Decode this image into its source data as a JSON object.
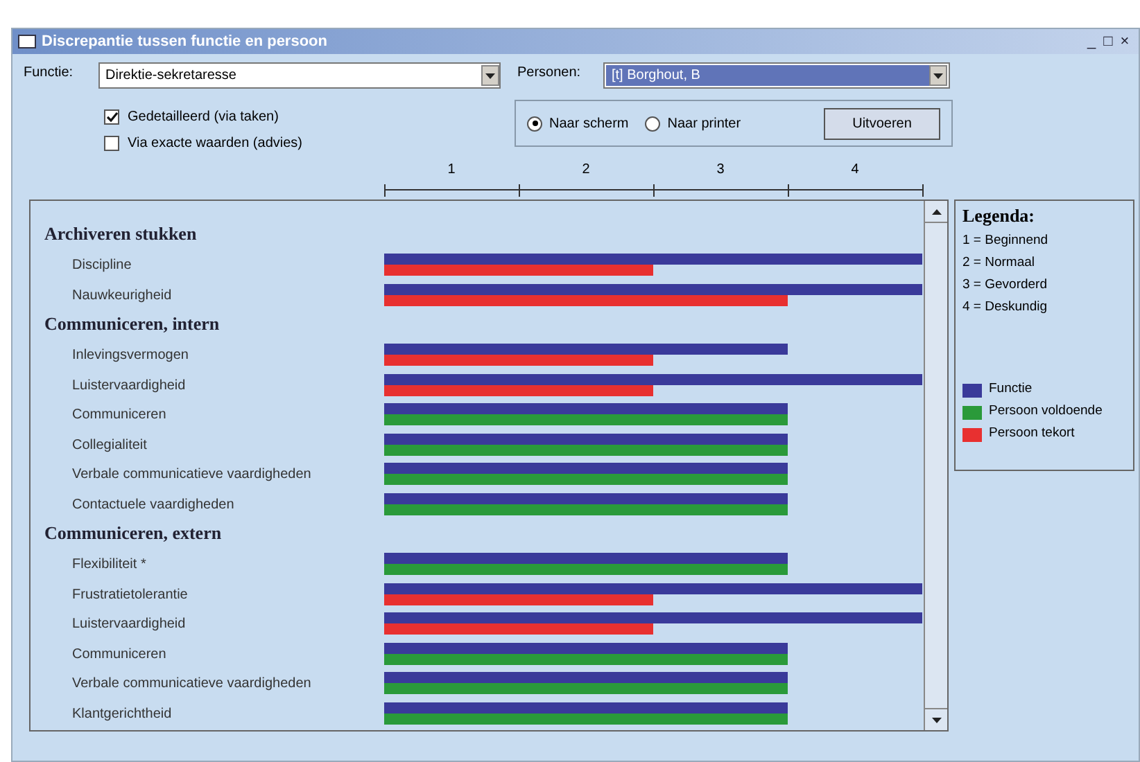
{
  "window": {
    "title": "Discrepantie tussen functie en persoon",
    "controls": [
      "_",
      "□",
      "×"
    ]
  },
  "functie": {
    "label": "Functie:",
    "value": "Direktie-sekretaresse"
  },
  "personen": {
    "label": "Personen:",
    "value": "[t] Borghout, B"
  },
  "options": [
    {
      "label": "Gedetailleerd (via taken)",
      "checked": true
    },
    {
      "label": "Via exacte waarden (advies)",
      "checked": false
    }
  ],
  "output": [
    {
      "label": "Naar scherm",
      "selected": true
    },
    {
      "label": "Naar printer",
      "selected": false
    }
  ],
  "run_button": "Uitvoeren",
  "chart": {
    "chart_data": {
      "type": "bar",
      "orientation": "horizontal",
      "categories": [
        "Discipline",
        "Nauwkeurigheid",
        "Inlevingsvermogen",
        "Luistervaardigheid",
        "Communiceren",
        "Collegialiteit",
        "Verbale communicatieve vaardigheden",
        "Contactuele vaardigheden",
        "Flexibiliteit *",
        "Frustratietolerantie",
        "Luistervaardigheid",
        "Communiceren",
        "Verbale communicatieve vaardigheden",
        "Klantgerichtheid"
      ],
      "xlim": [
        0,
        4
      ],
      "xticks": [
        {
          "value": 0.5,
          "label": "1"
        },
        {
          "value": 1.5,
          "label": "2"
        },
        {
          "value": 2.5,
          "label": "3"
        },
        {
          "value": 3.5,
          "label": "4"
        }
      ],
      "series": [
        {
          "name": "Functie",
          "color": "#3a3a9a",
          "values": [
            4,
            4,
            3,
            4,
            3,
            3,
            3,
            3,
            3,
            4,
            4,
            3,
            3,
            3
          ]
        },
        {
          "name": "Persoon voldoende",
          "color": "#2a9a3a",
          "values": [
            null,
            null,
            null,
            null,
            3,
            3,
            3,
            3,
            3,
            null,
            null,
            3,
            3,
            3
          ]
        },
        {
          "name": "Persoon tekort",
          "color": "#e83030",
          "values": [
            2,
            3,
            2,
            2,
            null,
            null,
            null,
            null,
            null,
            2,
            2,
            null,
            null,
            null
          ]
        }
      ],
      "legend": "right",
      "annotations": [
        "Archiveren stukken",
        "Communiceren, intern",
        "Communiceren, extern"
      ]
    },
    "legend": {
      "title": "Legenda:",
      "levels": [
        "1 = Beginnend",
        "2 = Normaal",
        "3 = Gevorderd",
        "4 = Deskundig"
      ]
    }
  }
}
